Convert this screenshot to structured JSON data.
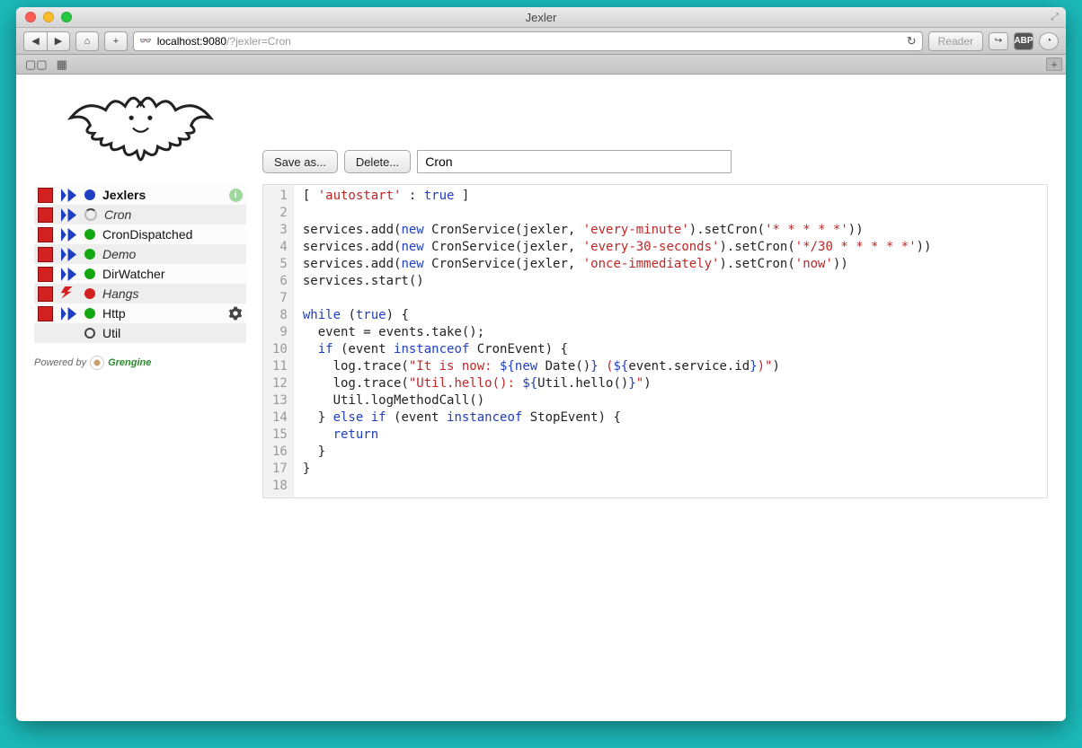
{
  "window": {
    "title": "Jexler"
  },
  "browser": {
    "url_host": "localhost:9080",
    "url_path": "/?jexler=Cron",
    "reader_label": "Reader"
  },
  "sidebar": {
    "items": [
      {
        "name": "Jexlers",
        "status": "blue",
        "bold": true,
        "italic": false,
        "right_icon": "info",
        "stop": true,
        "play": true,
        "spinner": false
      },
      {
        "name": "Cron",
        "status": "spinner",
        "bold": false,
        "italic": true,
        "right_icon": null,
        "stop": true,
        "play": true,
        "spinner": true
      },
      {
        "name": "CronDispatched",
        "status": "green",
        "bold": false,
        "italic": false,
        "right_icon": null,
        "stop": true,
        "play": true,
        "spinner": false
      },
      {
        "name": "Demo",
        "status": "green",
        "bold": false,
        "italic": true,
        "right_icon": null,
        "stop": true,
        "play": true,
        "spinner": false
      },
      {
        "name": "DirWatcher",
        "status": "green",
        "bold": false,
        "italic": false,
        "right_icon": null,
        "stop": true,
        "play": true,
        "spinner": false
      },
      {
        "name": "Hangs",
        "status": "red",
        "bold": false,
        "italic": true,
        "right_icon": null,
        "stop": true,
        "play": false,
        "fault": true
      },
      {
        "name": "Http",
        "status": "green",
        "bold": false,
        "italic": false,
        "right_icon": "cog",
        "stop": true,
        "play": true,
        "spinner": false
      },
      {
        "name": "Util",
        "status": "ring",
        "bold": false,
        "italic": false,
        "right_icon": null,
        "stop": false,
        "play": false,
        "spinner": false
      }
    ],
    "powered_prefix": "Powered by",
    "powered_name": "Grengine"
  },
  "editor": {
    "save_label": "Save as...",
    "delete_label": "Delete...",
    "name_value": "Cron",
    "code_lines": [
      {
        "n": 1,
        "segs": [
          {
            "t": "[ "
          },
          {
            "t": "'autostart'",
            "c": "str"
          },
          {
            "t": " : "
          },
          {
            "t": "true",
            "c": "kw"
          },
          {
            "t": " ]"
          }
        ]
      },
      {
        "n": 2,
        "segs": [
          {
            "t": ""
          }
        ]
      },
      {
        "n": 3,
        "segs": [
          {
            "t": "services.add("
          },
          {
            "t": "new",
            "c": "kw"
          },
          {
            "t": " CronService(jexler, "
          },
          {
            "t": "'every-minute'",
            "c": "str"
          },
          {
            "t": ").setCron("
          },
          {
            "t": "'* * * * *'",
            "c": "str"
          },
          {
            "t": "))"
          }
        ]
      },
      {
        "n": 4,
        "segs": [
          {
            "t": "services.add("
          },
          {
            "t": "new",
            "c": "kw"
          },
          {
            "t": " CronService(jexler, "
          },
          {
            "t": "'every-30-seconds'",
            "c": "str"
          },
          {
            "t": ").setCron("
          },
          {
            "t": "'*/30 * * * * *'",
            "c": "str"
          },
          {
            "t": "))"
          }
        ]
      },
      {
        "n": 5,
        "segs": [
          {
            "t": "services.add("
          },
          {
            "t": "new",
            "c": "kw"
          },
          {
            "t": " CronService(jexler, "
          },
          {
            "t": "'once-immediately'",
            "c": "str"
          },
          {
            "t": ").setCron("
          },
          {
            "t": "'now'",
            "c": "str"
          },
          {
            "t": "))"
          }
        ]
      },
      {
        "n": 6,
        "segs": [
          {
            "t": "services.start()"
          }
        ]
      },
      {
        "n": 7,
        "segs": [
          {
            "t": ""
          }
        ]
      },
      {
        "n": 8,
        "segs": [
          {
            "t": "while",
            "c": "kw"
          },
          {
            "t": " ("
          },
          {
            "t": "true",
            "c": "kw"
          },
          {
            "t": ") {"
          }
        ]
      },
      {
        "n": 9,
        "segs": [
          {
            "t": "  event = events.take();"
          }
        ]
      },
      {
        "n": 10,
        "segs": [
          {
            "t": "  "
          },
          {
            "t": "if",
            "c": "kw"
          },
          {
            "t": " (event "
          },
          {
            "t": "instanceof",
            "c": "kw"
          },
          {
            "t": " CronEvent) {"
          }
        ]
      },
      {
        "n": 11,
        "segs": [
          {
            "t": "    log.trace("
          },
          {
            "t": "\"It is now: ",
            "c": "str"
          },
          {
            "t": "${",
            "c": "var"
          },
          {
            "t": "new",
            "c": "kw"
          },
          {
            "t": " Date()"
          },
          {
            "t": "}",
            "c": "var"
          },
          {
            "t": " (",
            "c": "str"
          },
          {
            "t": "${",
            "c": "var"
          },
          {
            "t": "event.service.id"
          },
          {
            "t": "}",
            "c": "var"
          },
          {
            "t": ")\"",
            "c": "str"
          },
          {
            "t": ")"
          }
        ]
      },
      {
        "n": 12,
        "segs": [
          {
            "t": "    log.trace("
          },
          {
            "t": "\"Util.hello(): ",
            "c": "str"
          },
          {
            "t": "${",
            "c": "var"
          },
          {
            "t": "Util.hello()"
          },
          {
            "t": "}",
            "c": "var"
          },
          {
            "t": "\"",
            "c": "str"
          },
          {
            "t": ")"
          }
        ]
      },
      {
        "n": 13,
        "segs": [
          {
            "t": "    Util.logMethodCall()"
          }
        ]
      },
      {
        "n": 14,
        "segs": [
          {
            "t": "  } "
          },
          {
            "t": "else",
            "c": "kw"
          },
          {
            "t": " "
          },
          {
            "t": "if",
            "c": "kw"
          },
          {
            "t": " (event "
          },
          {
            "t": "instanceof",
            "c": "kw"
          },
          {
            "t": " StopEvent) {"
          }
        ]
      },
      {
        "n": 15,
        "segs": [
          {
            "t": "    "
          },
          {
            "t": "return",
            "c": "kw"
          }
        ]
      },
      {
        "n": 16,
        "segs": [
          {
            "t": "  }"
          }
        ]
      },
      {
        "n": 17,
        "segs": [
          {
            "t": "}"
          }
        ]
      },
      {
        "n": 18,
        "segs": [
          {
            "t": ""
          }
        ]
      }
    ]
  }
}
